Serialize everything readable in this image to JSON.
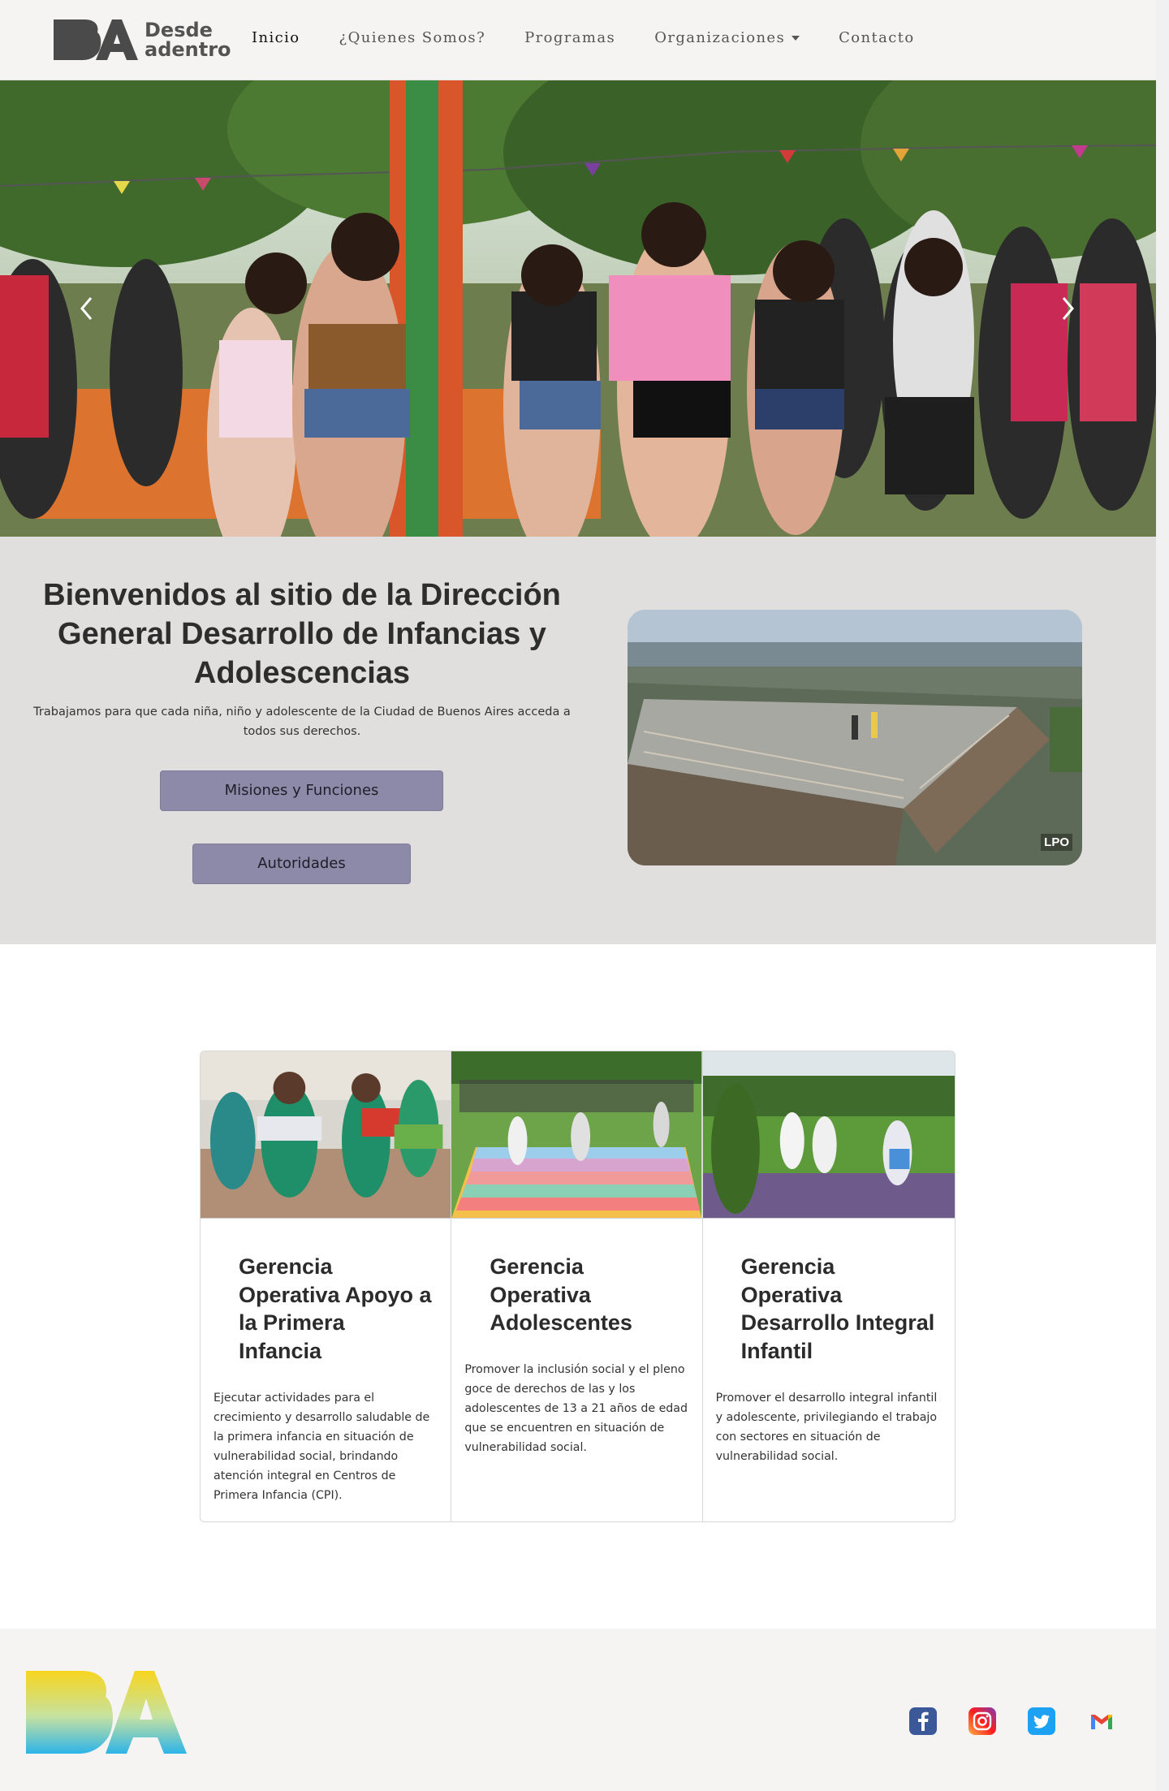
{
  "nav": {
    "brand_line1": "Desde",
    "brand_line2": "adentro",
    "links": [
      {
        "label": "Inicio",
        "active": true
      },
      {
        "label": "¿Quienes Somos?",
        "active": false
      },
      {
        "label": "Programas",
        "active": false
      },
      {
        "label": "Organizaciones",
        "active": false,
        "dropdown": true
      },
      {
        "label": "Contacto",
        "active": false
      }
    ]
  },
  "carousel": {
    "prev_icon": "chevron-left-icon",
    "next_icon": "chevron-right-icon"
  },
  "hero": {
    "title": "Bienvenidos al sitio de la Dirección General Desarrollo de Infancias y Adolescencias",
    "subtitle": "Trabajamos para que cada niña, niño y adolescente de la Ciudad de Buenos Aires acceda a todos sus derechos.",
    "buttons": {
      "missions": "Misiones y Funciones",
      "authorities": "Autoridades"
    },
    "image_watermark": "LPO"
  },
  "cards": [
    {
      "title": "Gerencia Operativa Apoyo a la Primera Infancia",
      "text": "Ejecutar actividades para el crecimiento y desarrollo saludable de la primera infancia en situación de vulnerabilidad social, brindando atención integral en Centros de Primera Infancia (CPI)."
    },
    {
      "title": "Gerencia Operativa Adolescentes",
      "text": "Promover la inclusión social y el pleno goce de derechos de las y los adolescentes de 13 a 21 años de edad que se encuentren en situación de vulnerabilidad social."
    },
    {
      "title": "Gerencia Operativa Desarrollo Integral Infantil",
      "text": "Promover el desarrollo integral infantil y adolescente, privilegiando el trabajo con sectores en situación de vulnerabilidad social."
    }
  ],
  "footer": {
    "social": [
      "facebook-icon",
      "instagram-icon",
      "twitter-icon",
      "gmail-icon"
    ]
  },
  "colors": {
    "nav_bg": "#f5f4f2",
    "hero_bg": "#e0dfdd",
    "button_bg": "#8c8aa8",
    "facebook": "#3b5998",
    "twitter": "#1da1f2",
    "gmail": "#ea4335"
  }
}
